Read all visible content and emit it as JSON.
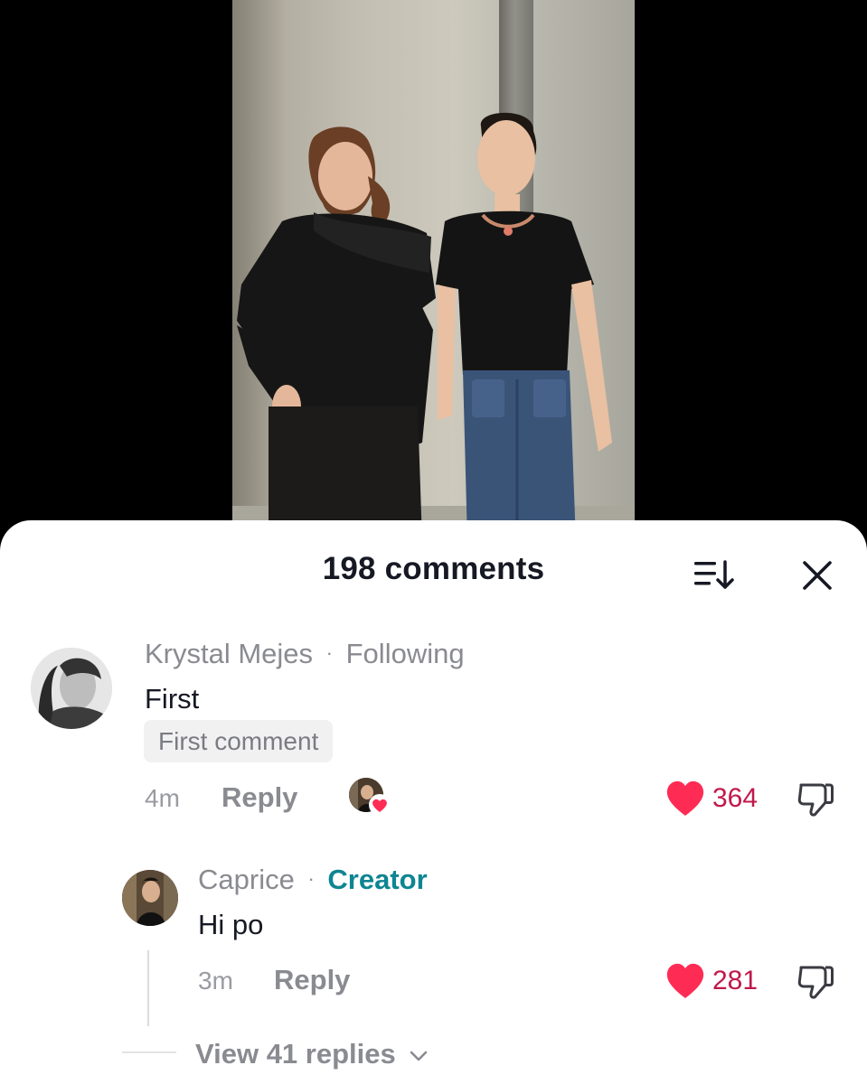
{
  "sheet": {
    "title": "198 comments",
    "sort_icon": "sort-descending-icon",
    "close_icon": "close-icon"
  },
  "comments": [
    {
      "username": "Krystal Mejes",
      "separator": "·",
      "relationship": "Following",
      "text": "First",
      "badge": "First comment",
      "time": "4m",
      "reply_label": "Reply",
      "liked_by_creator": true,
      "likes": "364"
    }
  ],
  "reply": {
    "username": "Caprice",
    "separator": "·",
    "tag": "Creator",
    "text": "Hi po",
    "time": "3m",
    "reply_label": "Reply",
    "likes": "281"
  },
  "view_replies": "View 41 replies",
  "colors": {
    "like_heart": "#fe2c55",
    "like_count": "#c0184a",
    "creator_tag": "#0e8592",
    "muted_text": "#8a8b91"
  }
}
